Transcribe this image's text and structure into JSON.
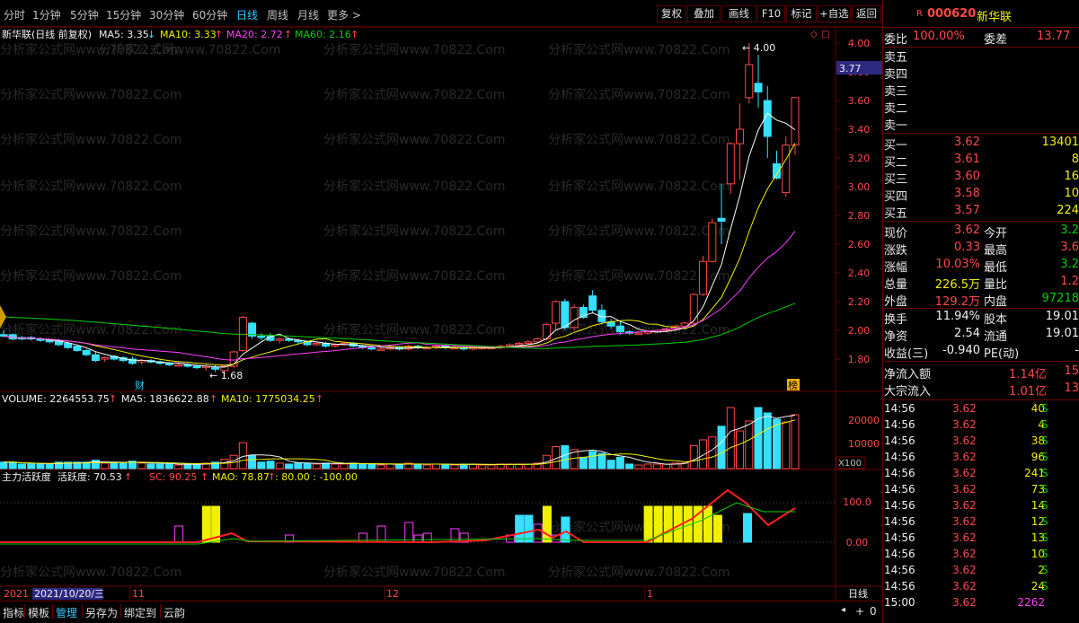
{
  "toolbar": {
    "periods": [
      "分时",
      "1分钟",
      "5分钟",
      "15分钟",
      "30分钟",
      "60分钟",
      "日线",
      "周线",
      "月线",
      "更多 >"
    ],
    "active_period": "日线",
    "buttons": [
      "复权",
      "叠加",
      "画线",
      "F10",
      "标记",
      "+自选",
      "返回"
    ]
  },
  "stock": {
    "code": "000620",
    "name": "新华联",
    "r_badge": "R"
  },
  "chart_labels": {
    "title": "新华联(日线 前复权)",
    "ma5": "MA5: 3.35",
    "ma10": "MA10: 3.33",
    "ma20": "MA20: 2.72",
    "ma60": "MA60: 2.16",
    "high_mark": "4.00",
    "low_mark": "1.68",
    "price_tag": "3.77",
    "cai": "财",
    "bang": "榜",
    "vol_title": "VOLUME: 2264553.75",
    "vol_ma5": "MA5: 1836622.88",
    "vol_ma10": "MA10: 1775034.25",
    "vol_unit": "X100",
    "ind_title": "主力活跃度",
    "ind_val": "活跃度: 70.53",
    "ind_sc": "SC: 90.25",
    "ind_mao": "MAO: 78.87",
    "ind_levels": ": 80.00 : -100.00",
    "axis_date": "2021/10/20/三",
    "axis_left": "2021",
    "period_name": "日线",
    "watermark": "分析家公式网www.70822.Com"
  },
  "axes": {
    "price_ticks": [
      "4.00",
      "3.80",
      "3.60",
      "3.40",
      "3.20",
      "3.00",
      "2.80",
      "2.60",
      "2.40",
      "2.20",
      "2.00",
      "1.80"
    ],
    "vol_ticks": [
      "20000",
      "10000"
    ],
    "ind_ticks": [
      "100.0",
      "0.00"
    ],
    "month_ticks": [
      "11",
      "12",
      "1"
    ]
  },
  "quote": {
    "weibi_label": "委比",
    "weibi": "100.00%",
    "weicha_label": "委差",
    "weicha": "13.77",
    "sell": [
      {
        "label": "卖五"
      },
      {
        "label": "卖四"
      },
      {
        "label": "卖三"
      },
      {
        "label": "卖二"
      },
      {
        "label": "卖一"
      }
    ],
    "buy": [
      {
        "label": "买一",
        "price": "3.62",
        "vol": "13401"
      },
      {
        "label": "买二",
        "price": "3.61",
        "vol": "8"
      },
      {
        "label": "买三",
        "price": "3.60",
        "vol": "16"
      },
      {
        "label": "买四",
        "price": "3.58",
        "vol": "10"
      },
      {
        "label": "买五",
        "price": "3.57",
        "vol": "224"
      }
    ],
    "stats": [
      {
        "l1": "现价",
        "v1": "3.62",
        "c1": "red",
        "l2": "今开",
        "v2": "3.2",
        "c2": "grn"
      },
      {
        "l1": "涨跌",
        "v1": "0.33",
        "c1": "red",
        "l2": "最高",
        "v2": "3.6",
        "c2": "red"
      },
      {
        "l1": "涨幅",
        "v1": "10.03%",
        "c1": "red",
        "l2": "最低",
        "v2": "3.2",
        "c2": "grn"
      },
      {
        "l1": "总量",
        "v1": "226.5万",
        "c1": "yel",
        "l2": "量比",
        "v2": "1.2",
        "c2": "red"
      },
      {
        "l1": "外盘",
        "v1": "129.2万",
        "c1": "red",
        "l2": "内盘",
        "v2": "97218",
        "c2": "grn"
      }
    ],
    "stats2": [
      {
        "l1": "换手",
        "v1": "11.94%",
        "c1": "wht",
        "l2": "股本",
        "v2": "19.01",
        "c2": "wht"
      },
      {
        "l1": "净资",
        "v1": "2.54",
        "c1": "wht",
        "l2": "流通",
        "v2": "19.01",
        "c2": "wht"
      },
      {
        "l1": "收益(三)",
        "v1": "-0.940",
        "c1": "wht",
        "l2": "PE(动)",
        "v2": "-",
        "c2": "wht"
      }
    ],
    "flow": [
      {
        "label": "净流入额",
        "v1": "1.14亿",
        "v2": "15"
      },
      {
        "label": "大宗流入",
        "v1": "1.01亿",
        "v2": "13"
      }
    ],
    "ticks": [
      {
        "t": "14:56",
        "p": "3.62",
        "v": "40",
        "s": "S"
      },
      {
        "t": "14:56",
        "p": "3.62",
        "v": "4",
        "s": "S"
      },
      {
        "t": "14:56",
        "p": "3.62",
        "v": "38",
        "s": "S"
      },
      {
        "t": "14:56",
        "p": "3.62",
        "v": "96",
        "s": "S"
      },
      {
        "t": "14:56",
        "p": "3.62",
        "v": "241",
        "s": "S"
      },
      {
        "t": "14:56",
        "p": "3.62",
        "v": "73",
        "s": "S"
      },
      {
        "t": "14:56",
        "p": "3.62",
        "v": "14",
        "s": "S"
      },
      {
        "t": "14:56",
        "p": "3.62",
        "v": "12",
        "s": "S"
      },
      {
        "t": "14:56",
        "p": "3.62",
        "v": "13",
        "s": "S"
      },
      {
        "t": "14:56",
        "p": "3.62",
        "v": "10",
        "s": "S"
      },
      {
        "t": "14:56",
        "p": "3.62",
        "v": "2",
        "s": "S"
      },
      {
        "t": "14:56",
        "p": "3.62",
        "v": "24",
        "s": "S"
      },
      {
        "t": "15:00",
        "p": "3.62",
        "v": "2262",
        "s": ""
      }
    ]
  },
  "bottom_tabs": [
    "指标",
    "模板",
    "管理",
    "另存为",
    "绑定到",
    "云韵"
  ],
  "colors": {
    "up": "#ff4848",
    "down": "#36e0ff",
    "ma5": "#ffffff",
    "ma10": "#f0f000",
    "ma20": "#ff40ff",
    "ma60": "#00d000",
    "frame": "#6a0000",
    "active_tab": "#36c9ff"
  },
  "chart_data": {
    "type": "candlestick",
    "price_range": [
      1.68,
      4.0
    ],
    "candles": [
      {
        "o": 1.97,
        "h": 2.0,
        "l": 1.95,
        "c": 1.96
      },
      {
        "o": 1.97,
        "h": 1.98,
        "l": 1.93,
        "c": 1.94
      },
      {
        "o": 1.95,
        "h": 1.96,
        "l": 1.93,
        "c": 1.94
      },
      {
        "o": 1.95,
        "h": 1.96,
        "l": 1.93,
        "c": 1.94
      },
      {
        "o": 1.94,
        "h": 1.95,
        "l": 1.92,
        "c": 1.93
      },
      {
        "o": 1.93,
        "h": 1.94,
        "l": 1.91,
        "c": 1.92
      },
      {
        "o": 1.93,
        "h": 1.94,
        "l": 1.89,
        "c": 1.9
      },
      {
        "o": 1.91,
        "h": 1.92,
        "l": 1.87,
        "c": 1.88
      },
      {
        "o": 1.89,
        "h": 1.9,
        "l": 1.85,
        "c": 1.86
      },
      {
        "o": 1.86,
        "h": 1.87,
        "l": 1.82,
        "c": 1.83
      },
      {
        "o": 1.83,
        "h": 1.85,
        "l": 1.78,
        "c": 1.79
      },
      {
        "o": 1.8,
        "h": 1.82,
        "l": 1.78,
        "c": 1.81
      },
      {
        "o": 1.82,
        "h": 1.83,
        "l": 1.79,
        "c": 1.8
      },
      {
        "o": 1.81,
        "h": 1.82,
        "l": 1.78,
        "c": 1.79
      },
      {
        "o": 1.8,
        "h": 1.82,
        "l": 1.76,
        "c": 1.77
      },
      {
        "o": 1.78,
        "h": 1.8,
        "l": 1.76,
        "c": 1.79
      },
      {
        "o": 1.79,
        "h": 1.8,
        "l": 1.77,
        "c": 1.78
      },
      {
        "o": 1.78,
        "h": 1.79,
        "l": 1.76,
        "c": 1.77
      },
      {
        "o": 1.77,
        "h": 1.78,
        "l": 1.75,
        "c": 1.76
      },
      {
        "o": 1.76,
        "h": 1.77,
        "l": 1.75,
        "c": 1.76
      },
      {
        "o": 1.76,
        "h": 1.77,
        "l": 1.74,
        "c": 1.75
      },
      {
        "o": 1.75,
        "h": 1.76,
        "l": 1.73,
        "c": 1.74
      },
      {
        "o": 1.74,
        "h": 1.76,
        "l": 1.72,
        "c": 1.75
      },
      {
        "o": 1.74,
        "h": 1.76,
        "l": 1.71,
        "c": 1.73
      },
      {
        "o": 1.72,
        "h": 1.76,
        "l": 1.68,
        "c": 1.75
      },
      {
        "o": 1.75,
        "h": 1.86,
        "l": 1.74,
        "c": 1.85
      },
      {
        "o": 1.86,
        "h": 2.1,
        "l": 1.85,
        "c": 2.09
      },
      {
        "o": 2.05,
        "h": 2.06,
        "l": 1.94,
        "c": 1.96
      },
      {
        "o": 1.96,
        "h": 1.98,
        "l": 1.93,
        "c": 1.95
      },
      {
        "o": 1.96,
        "h": 1.98,
        "l": 1.92,
        "c": 1.93
      },
      {
        "o": 1.93,
        "h": 1.95,
        "l": 1.91,
        "c": 1.94
      },
      {
        "o": 1.94,
        "h": 1.95,
        "l": 1.92,
        "c": 1.93
      },
      {
        "o": 1.93,
        "h": 1.94,
        "l": 1.9,
        "c": 1.92
      },
      {
        "o": 1.92,
        "h": 1.93,
        "l": 1.89,
        "c": 1.9
      },
      {
        "o": 1.9,
        "h": 1.92,
        "l": 1.89,
        "c": 1.91
      },
      {
        "o": 1.91,
        "h": 1.92,
        "l": 1.88,
        "c": 1.89
      },
      {
        "o": 1.89,
        "h": 1.91,
        "l": 1.88,
        "c": 1.9
      },
      {
        "o": 1.9,
        "h": 1.92,
        "l": 1.89,
        "c": 1.91
      },
      {
        "o": 1.91,
        "h": 1.92,
        "l": 1.88,
        "c": 1.89
      },
      {
        "o": 1.89,
        "h": 1.9,
        "l": 1.87,
        "c": 1.88
      },
      {
        "o": 1.88,
        "h": 1.89,
        "l": 1.86,
        "c": 1.87
      },
      {
        "o": 1.87,
        "h": 1.88,
        "l": 1.86,
        "c": 1.87
      },
      {
        "o": 1.87,
        "h": 1.89,
        "l": 1.86,
        "c": 1.88
      },
      {
        "o": 1.88,
        "h": 1.89,
        "l": 1.86,
        "c": 1.87
      },
      {
        "o": 1.87,
        "h": 1.9,
        "l": 1.86,
        "c": 1.89
      },
      {
        "o": 1.89,
        "h": 1.9,
        "l": 1.87,
        "c": 1.88
      },
      {
        "o": 1.88,
        "h": 1.89,
        "l": 1.87,
        "c": 1.88
      },
      {
        "o": 1.88,
        "h": 1.9,
        "l": 1.87,
        "c": 1.89
      },
      {
        "o": 1.89,
        "h": 1.9,
        "l": 1.87,
        "c": 1.88
      },
      {
        "o": 1.88,
        "h": 1.89,
        "l": 1.87,
        "c": 1.88
      },
      {
        "o": 1.88,
        "h": 1.89,
        "l": 1.86,
        "c": 1.87
      },
      {
        "o": 1.87,
        "h": 1.89,
        "l": 1.86,
        "c": 1.88
      },
      {
        "o": 1.88,
        "h": 1.89,
        "l": 1.87,
        "c": 1.88
      },
      {
        "o": 1.88,
        "h": 1.89,
        "l": 1.87,
        "c": 1.88
      },
      {
        "o": 1.88,
        "h": 1.9,
        "l": 1.87,
        "c": 1.89
      },
      {
        "o": 1.89,
        "h": 1.91,
        "l": 1.88,
        "c": 1.9
      },
      {
        "o": 1.9,
        "h": 1.92,
        "l": 1.89,
        "c": 1.91
      },
      {
        "o": 1.91,
        "h": 1.93,
        "l": 1.9,
        "c": 1.92
      },
      {
        "o": 1.92,
        "h": 1.95,
        "l": 1.91,
        "c": 1.94
      },
      {
        "o": 1.94,
        "h": 2.05,
        "l": 1.93,
        "c": 2.04
      },
      {
        "o": 2.05,
        "h": 2.21,
        "l": 2.0,
        "c": 2.2
      },
      {
        "o": 2.2,
        "h": 2.22,
        "l": 2.0,
        "c": 2.02
      },
      {
        "o": 2.02,
        "h": 2.18,
        "l": 2.0,
        "c": 2.16
      },
      {
        "o": 2.16,
        "h": 2.18,
        "l": 2.08,
        "c": 2.09
      },
      {
        "o": 2.24,
        "h": 2.28,
        "l": 2.12,
        "c": 2.14
      },
      {
        "o": 2.14,
        "h": 2.18,
        "l": 2.04,
        "c": 2.06
      },
      {
        "o": 2.06,
        "h": 2.08,
        "l": 2.01,
        "c": 2.03
      },
      {
        "o": 2.03,
        "h": 2.07,
        "l": 1.97,
        "c": 1.99
      },
      {
        "o": 1.99,
        "h": 2.0,
        "l": 1.97,
        "c": 1.98
      },
      {
        "o": 1.98,
        "h": 1.99,
        "l": 1.97,
        "c": 1.98
      },
      {
        "o": 1.98,
        "h": 2.0,
        "l": 1.97,
        "c": 1.99
      },
      {
        "o": 1.99,
        "h": 2.01,
        "l": 1.98,
        "c": 2.0
      },
      {
        "o": 2.0,
        "h": 2.02,
        "l": 1.99,
        "c": 2.01
      },
      {
        "o": 2.01,
        "h": 2.04,
        "l": 2.0,
        "c": 2.03
      },
      {
        "o": 2.03,
        "h": 2.06,
        "l": 2.02,
        "c": 2.05
      },
      {
        "o": 2.05,
        "h": 2.26,
        "l": 2.04,
        "c": 2.25
      },
      {
        "o": 2.25,
        "h": 2.52,
        "l": 2.24,
        "c": 2.48
      },
      {
        "o": 2.48,
        "h": 2.78,
        "l": 2.47,
        "c": 2.75
      },
      {
        "o": 2.78,
        "h": 3.02,
        "l": 2.6,
        "c": 2.76
      },
      {
        "o": 3.02,
        "h": 3.31,
        "l": 2.95,
        "c": 3.3
      },
      {
        "o": 3.3,
        "h": 3.58,
        "l": 3.05,
        "c": 3.4
      },
      {
        "o": 3.62,
        "h": 4.0,
        "l": 3.58,
        "c": 3.85
      },
      {
        "o": 3.72,
        "h": 3.92,
        "l": 3.55,
        "c": 3.66
      },
      {
        "o": 3.6,
        "h": 3.7,
        "l": 3.2,
        "c": 3.35
      },
      {
        "o": 3.16,
        "h": 3.25,
        "l": 3.05,
        "c": 3.06
      },
      {
        "o": 2.96,
        "h": 3.35,
        "l": 2.93,
        "c": 3.29
      },
      {
        "o": 3.29,
        "h": 3.62,
        "l": 3.22,
        "c": 3.62
      }
    ]
  }
}
